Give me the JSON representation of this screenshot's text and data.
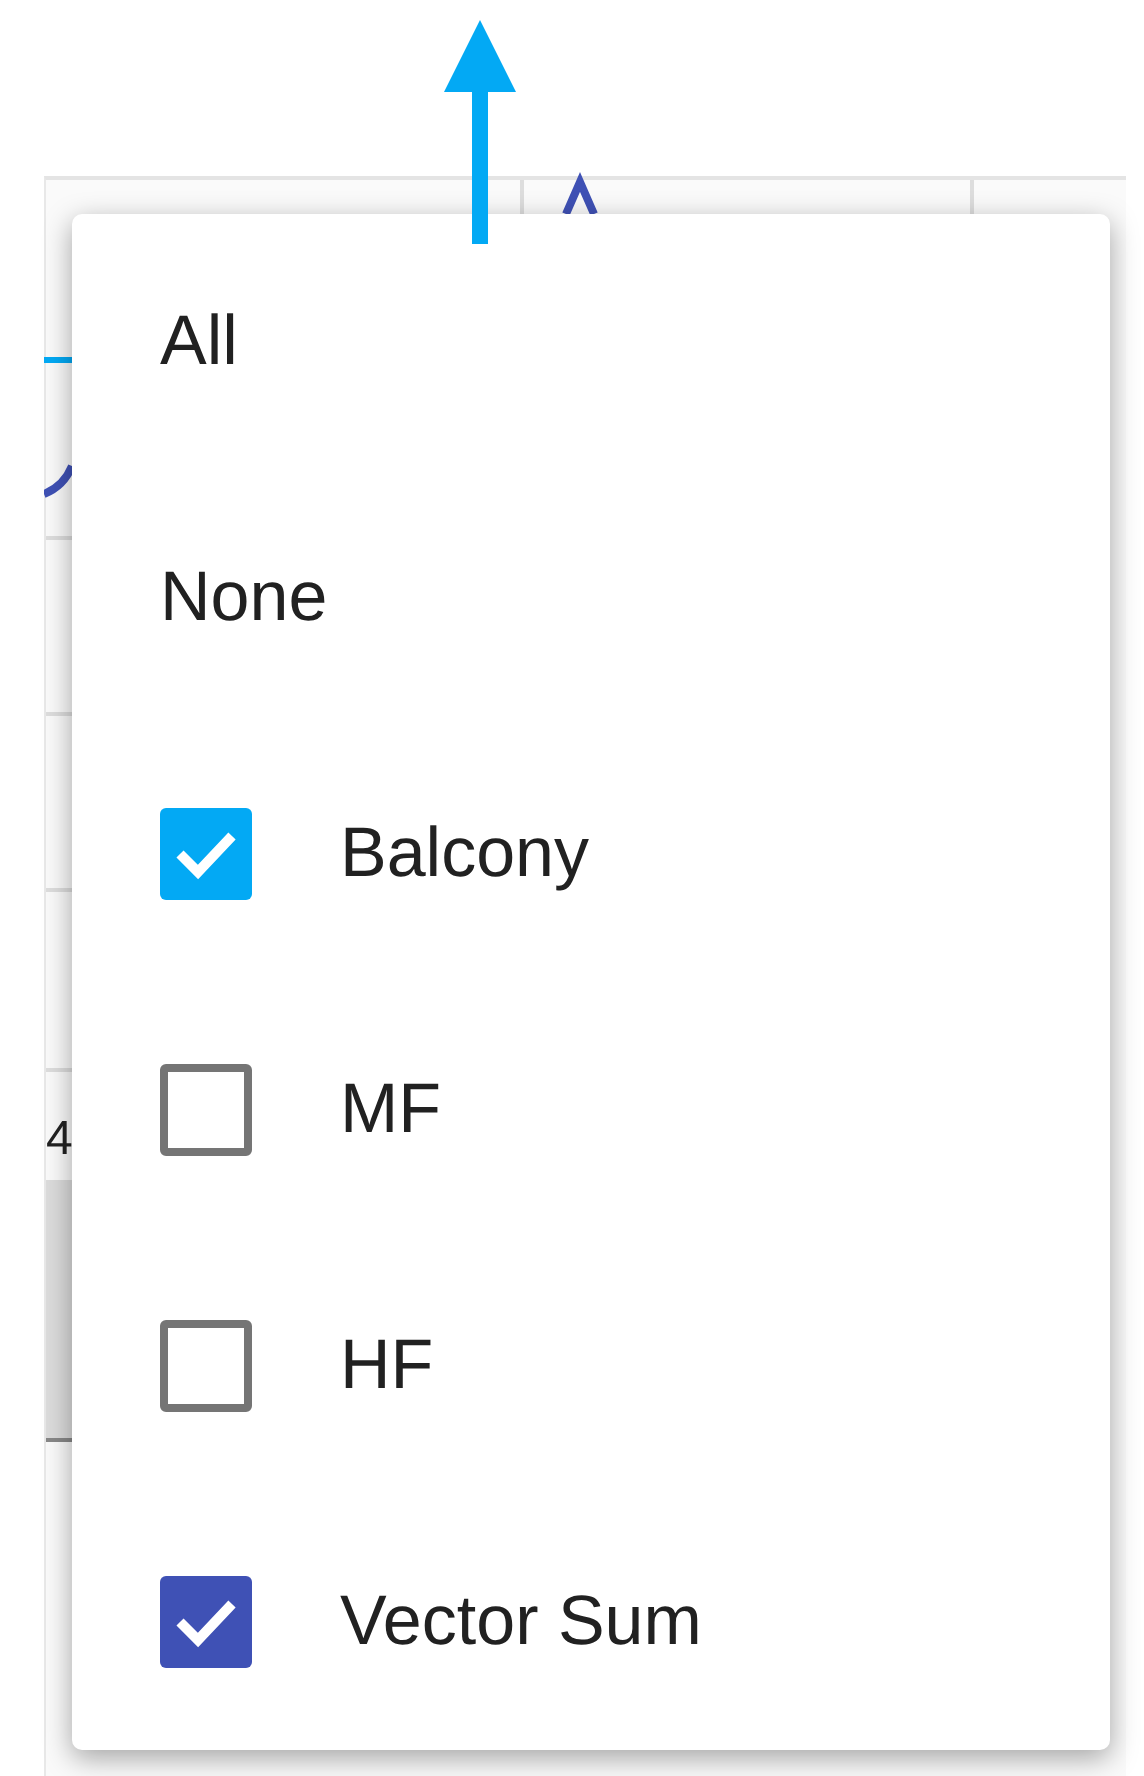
{
  "background": {
    "axis_fragment": "4"
  },
  "menu": {
    "items": [
      {
        "kind": "action",
        "label": "All"
      },
      {
        "kind": "action",
        "label": "None"
      },
      {
        "kind": "checkbox",
        "label": "Balcony",
        "checked": true,
        "color": "#03a9f4"
      },
      {
        "kind": "checkbox",
        "label": "MF",
        "checked": false
      },
      {
        "kind": "checkbox",
        "label": "HF",
        "checked": false
      },
      {
        "kind": "checkbox",
        "label": "Vector Sum",
        "checked": true,
        "color": "#3f51b5"
      }
    ]
  }
}
